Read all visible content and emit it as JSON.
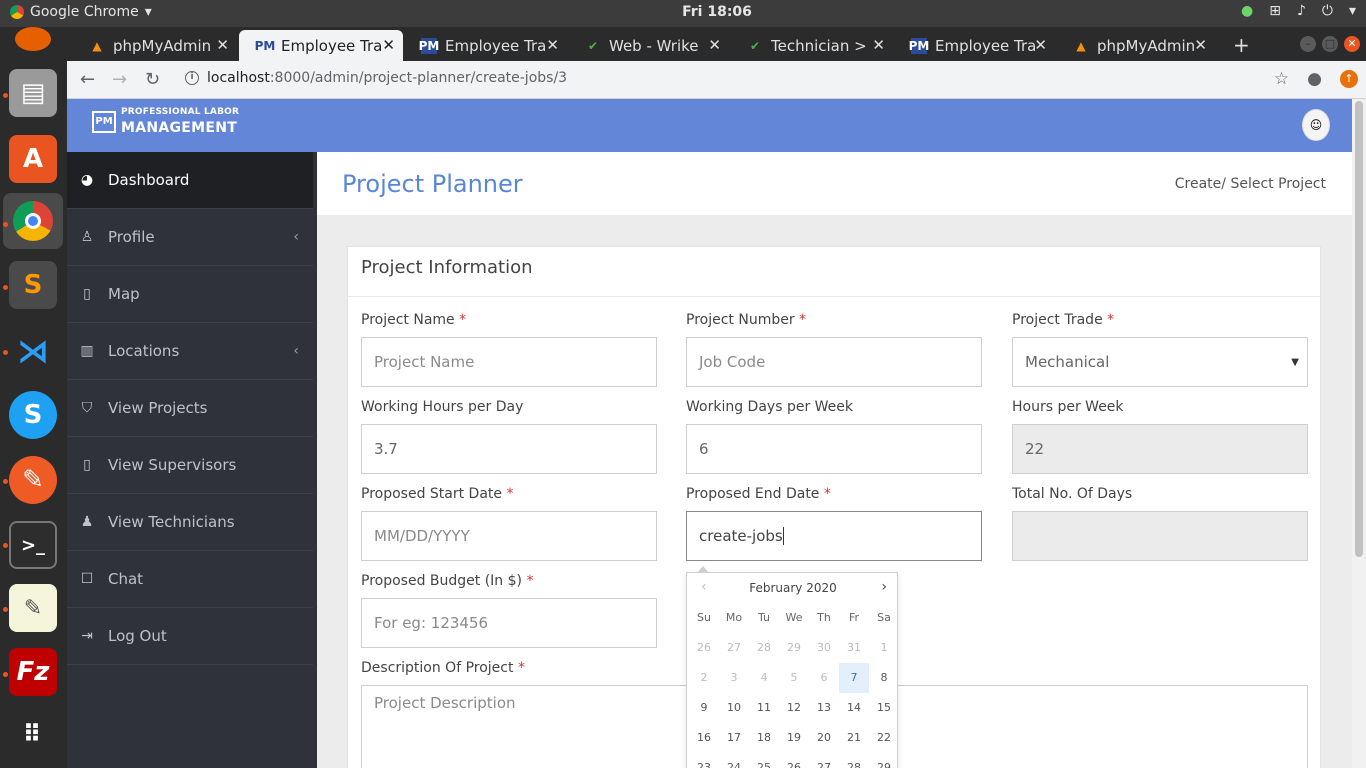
{
  "os": {
    "app_name": "Google Chrome",
    "app_menu_arrow": "▾",
    "clock": "Fri 18:06",
    "tray_icons": [
      "shield-check-icon",
      "network-icon",
      "volume-icon",
      "power-icon"
    ]
  },
  "dock": {
    "items": [
      "firefox-icon",
      "files-icon",
      "software-center-icon",
      "chrome-icon",
      "sublime-text-icon",
      "vscode-icon",
      "skype-icon",
      "postman-icon",
      "terminal-icon",
      "text-editor-icon",
      "filezilla-icon",
      "apps-grid-icon"
    ]
  },
  "browser": {
    "tabs": [
      {
        "title": "phpMyAdmin",
        "icon": "phpmyadmin-icon"
      },
      {
        "title": "Employee Trac",
        "icon": "pm-logo-icon",
        "active": true
      },
      {
        "title": "Employee Trac",
        "icon": "pm-logo-icon"
      },
      {
        "title": "Web - Wrike",
        "icon": "check-icon"
      },
      {
        "title": "Technician > C",
        "icon": "check-icon"
      },
      {
        "title": "Employee Trac",
        "icon": "pm-logo-icon"
      },
      {
        "title": "phpMyAdmin",
        "icon": "phpmyadmin-icon"
      }
    ],
    "url_host": "localhost",
    "url_path": ":8000/admin/project-planner/create-jobs/3"
  },
  "brand": {
    "line1": "PROFESSIONAL LABOR",
    "line2": "MANAGEMENT",
    "logo_text": "PM"
  },
  "sidebar": {
    "items": [
      {
        "label": "Dashboard",
        "icon": "dashboard-icon"
      },
      {
        "label": "Profile",
        "icon": "user-icon",
        "chevron": "‹"
      },
      {
        "label": "Map",
        "icon": "map-icon"
      },
      {
        "label": "Locations",
        "icon": "locations-icon",
        "chevron": "‹"
      },
      {
        "label": "View Projects",
        "icon": "projects-icon"
      },
      {
        "label": "View Supervisors",
        "icon": "supervisors-icon"
      },
      {
        "label": "View Technicians",
        "icon": "technicians-icon"
      },
      {
        "label": "Chat",
        "icon": "chat-icon"
      },
      {
        "label": "Log Out",
        "icon": "logout-icon"
      }
    ]
  },
  "page": {
    "title": "Project Planner",
    "breadcrumb": "Create/ Select Project"
  },
  "form": {
    "section_title": "Project Information",
    "required_mark": "*",
    "project_name": {
      "label": "Project Name",
      "placeholder": "Project Name",
      "value": ""
    },
    "project_number": {
      "label": "Project Number",
      "placeholder": "Job Code",
      "value": ""
    },
    "project_trade": {
      "label": "Project Trade",
      "value": "Mechanical"
    },
    "working_hours": {
      "label": "Working Hours per Day",
      "value": "3.7"
    },
    "working_days": {
      "label": "Working Days per Week",
      "value": "6"
    },
    "hours_per_week": {
      "label": "Hours per Week",
      "value": "22"
    },
    "start_date": {
      "label": "Proposed Start Date",
      "placeholder": "MM/DD/YYYY",
      "value": ""
    },
    "end_date": {
      "label": "Proposed End Date",
      "value": "create-jobs"
    },
    "total_days": {
      "label": "Total No. Of Days",
      "value": ""
    },
    "budget": {
      "label": "Proposed Budget (In $)",
      "placeholder": "For eg: 123456",
      "value": ""
    },
    "description": {
      "label": "Description Of Project",
      "placeholder": "Project Description"
    }
  },
  "datepicker": {
    "month_label": "February 2020",
    "prev": "‹",
    "next": "›",
    "weekdays": [
      "Su",
      "Mo",
      "Tu",
      "We",
      "Th",
      "Fr",
      "Sa"
    ],
    "weeks": [
      [
        "26",
        "27",
        "28",
        "29",
        "30",
        "31",
        "1"
      ],
      [
        "2",
        "3",
        "4",
        "5",
        "6",
        "7",
        "8"
      ],
      [
        "9",
        "10",
        "11",
        "12",
        "13",
        "14",
        "15"
      ],
      [
        "16",
        "17",
        "18",
        "19",
        "20",
        "21",
        "22"
      ],
      [
        "23",
        "24",
        "25",
        "26",
        "27",
        "28",
        "29"
      ]
    ],
    "today": "7"
  }
}
